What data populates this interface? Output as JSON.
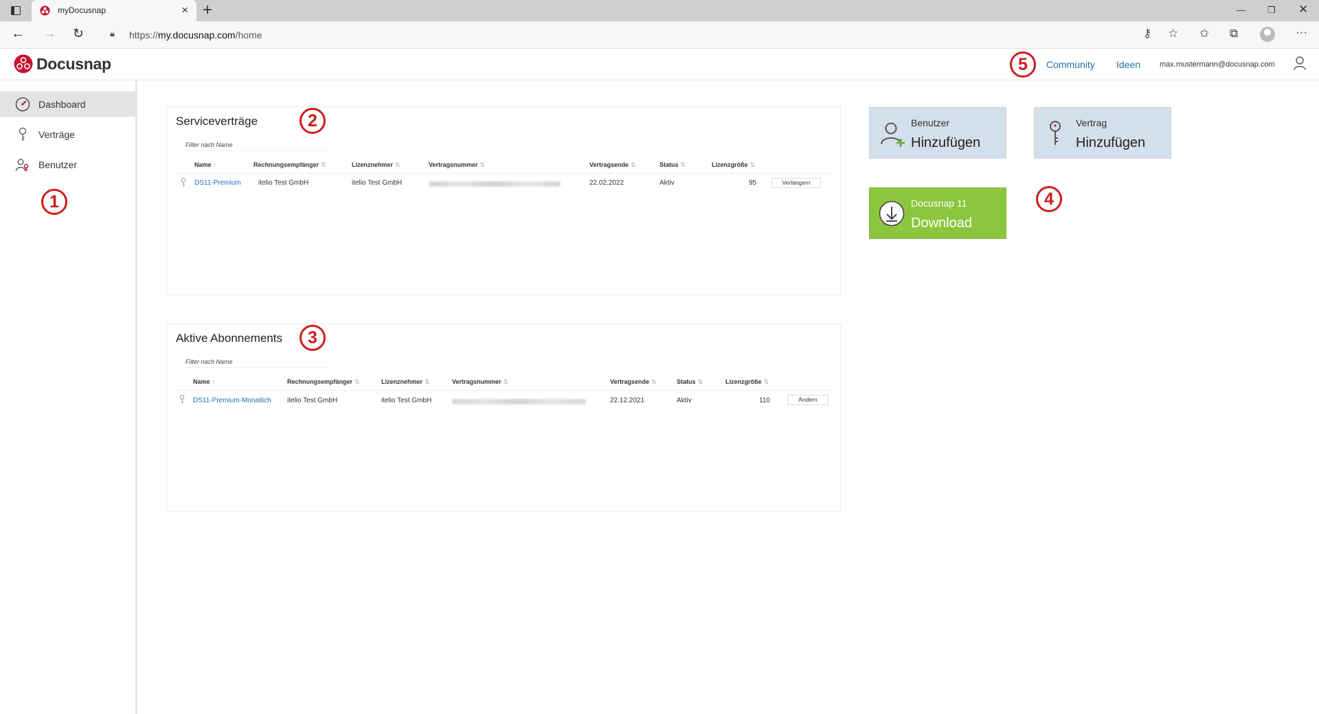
{
  "browser": {
    "tab_title": "myDocusnap",
    "url_prefix": "https://",
    "url_host": "my.docusnap.com",
    "url_path": "/home"
  },
  "header": {
    "brand": "Docusnap",
    "links": [
      "Community",
      "Ideen"
    ],
    "user_email": "max.mustermann@docusnap.com"
  },
  "markers": [
    "1",
    "2",
    "3",
    "4",
    "5"
  ],
  "sidebar": {
    "items": [
      {
        "label": "Dashboard",
        "icon": "gauge-icon",
        "active": true
      },
      {
        "label": "Verträge",
        "icon": "key-icon",
        "active": false
      },
      {
        "label": "Benutzer",
        "icon": "users-icon",
        "active": false
      }
    ]
  },
  "service_contracts": {
    "title": "Serviceverträge",
    "filter_placeholder": "Filter nach Name",
    "columns": [
      "Name",
      "Rechnungsempfänger",
      "Lizenznehmer",
      "Vertragsnummer",
      "Vertragsende",
      "Status",
      "Lizenzgröße"
    ],
    "rows": [
      {
        "name": "DS11-Premium",
        "recipient": "itelio Test GmbH",
        "licensee": "itelio Test GmbH",
        "contract_number": "",
        "end": "22.02.2022",
        "status": "Aktiv",
        "size": "95",
        "action": "Verlängern"
      }
    ]
  },
  "subscriptions": {
    "title": "Aktive Abonnements",
    "filter_placeholder": "Filter nach Name",
    "columns": [
      "Name",
      "Rechnungsempfänger",
      "Lizenznehmer",
      "Vertragsnummer",
      "Vertragsende",
      "Status",
      "Lizenzgröße"
    ],
    "rows": [
      {
        "name": "DS11-Premium-Monatlich",
        "recipient": "itelio Test GmbH",
        "licensee": "itelio Test GmbH",
        "contract_number": "",
        "end": "22.12.2021",
        "status": "Aktiv",
        "size": "110",
        "action": "Ändern"
      }
    ]
  },
  "tiles": {
    "add_user": {
      "small": "Benutzer",
      "big": "Hinzufügen"
    },
    "add_contract": {
      "small": "Vertrag",
      "big": "Hinzufügen"
    },
    "download": {
      "small": "Docusnap 11",
      "big": "Download"
    }
  },
  "colors": {
    "accent": "#1f6fb5",
    "marker": "#d11a1a",
    "tile_blue": "#d3dfea",
    "tile_green": "#8cc63f"
  }
}
